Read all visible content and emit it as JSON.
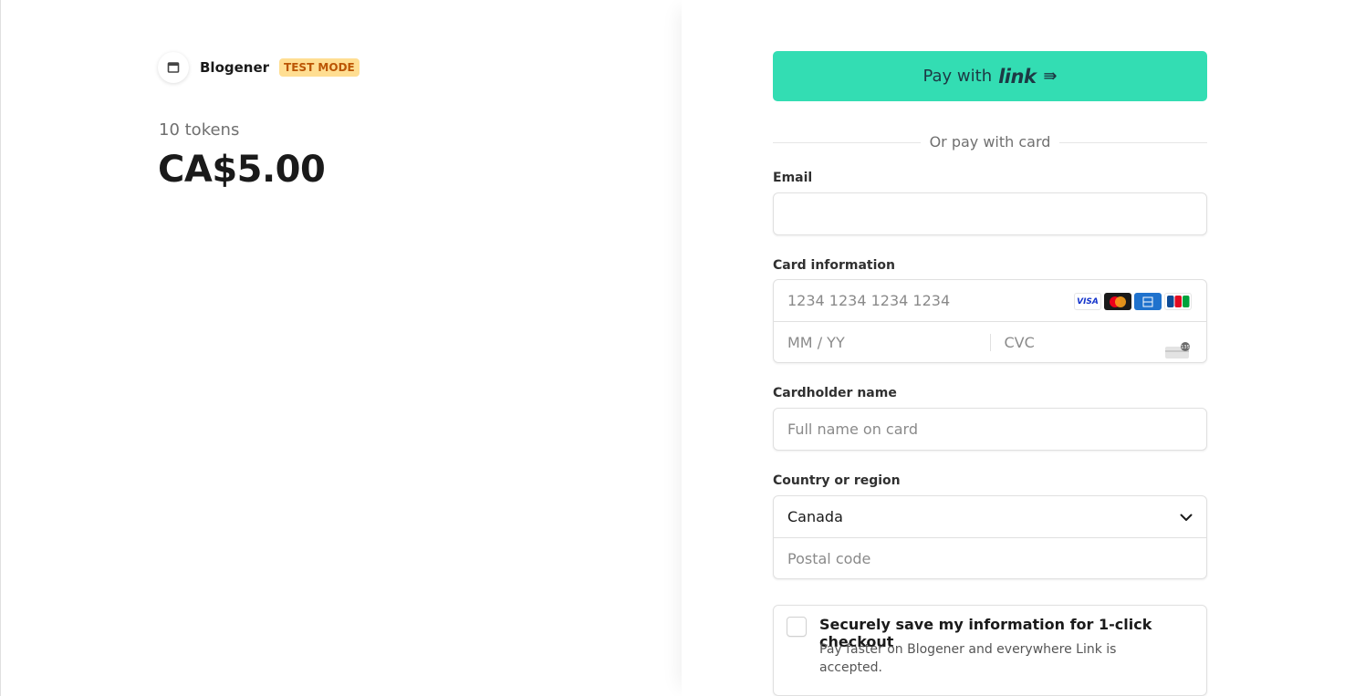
{
  "merchant": {
    "name": "Blogener",
    "badge": "TEST MODE",
    "logo_icon": "storefront-icon"
  },
  "product": {
    "name": "10 tokens",
    "price": "CA$5.00"
  },
  "link_button": {
    "pay_with": "Pay with",
    "brand": "link",
    "arrow": "⇛",
    "color": "#33ddb3"
  },
  "divider": {
    "text": "Or pay with card"
  },
  "email": {
    "label": "Email",
    "value": "",
    "placeholder": ""
  },
  "card": {
    "label": "Card information",
    "number_placeholder": "1234 1234 1234 1234",
    "expiry_placeholder": "MM / YY",
    "cvc_placeholder": "CVC",
    "brands": [
      "VISA",
      "mastercard",
      "amex",
      "jcb"
    ],
    "brand_icons": [
      "visa-icon",
      "mastercard-icon",
      "amex-icon",
      "jcb-icon"
    ],
    "cvc_icon": "cvc-card-icon"
  },
  "cardholder": {
    "label": "Cardholder name",
    "placeholder": "Full name on card"
  },
  "country": {
    "label": "Country or region",
    "selected": "Canada",
    "postal_placeholder": "Postal code"
  },
  "save_info": {
    "title": "Securely save my information for 1-click checkout",
    "description": "Pay faster on Blogener and everywhere Link is accepted."
  },
  "colors": {
    "test_badge_bg": "#ffde92",
    "test_badge_text": "#bb5504"
  }
}
